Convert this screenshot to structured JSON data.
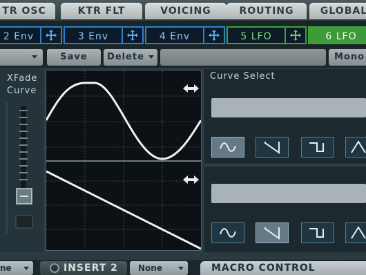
{
  "tabs": [
    "TR OSC",
    "KTR FLT",
    "VOICING",
    "ROUTING",
    "GLOBAL"
  ],
  "mod_sources": [
    {
      "label": "2 Env",
      "kind": "env"
    },
    {
      "label": "3 Env",
      "kind": "env"
    },
    {
      "label": "4 Env",
      "kind": "env"
    },
    {
      "label": "5 LFO",
      "kind": "lfo"
    },
    {
      "label": "6 LFO",
      "kind": "lfo",
      "active": true
    }
  ],
  "toolbar": {
    "save_label": "Save",
    "delete_label": "Delete",
    "mono_label": "Mono"
  },
  "xfade": {
    "label_line1": "XFade",
    "label_line2": "Curve"
  },
  "curve_select": {
    "title": "Curve Select"
  },
  "bottom": {
    "left_value": "ne",
    "insert_label": "INSERT 2",
    "insert_value": "None",
    "macro_label": "MACRO CONTROL"
  },
  "colors": {
    "env_border": "#2f7fd0",
    "lfo_border": "#3fa03c",
    "lfo_active": "#3f9a3a",
    "panel": "#24343a"
  },
  "icons": [
    "move-arrows-icon",
    "resize-horizontal-icon",
    "sine-wave-icon",
    "ramp-down-icon",
    "square-wave-icon",
    "triangle-wave-icon"
  ]
}
